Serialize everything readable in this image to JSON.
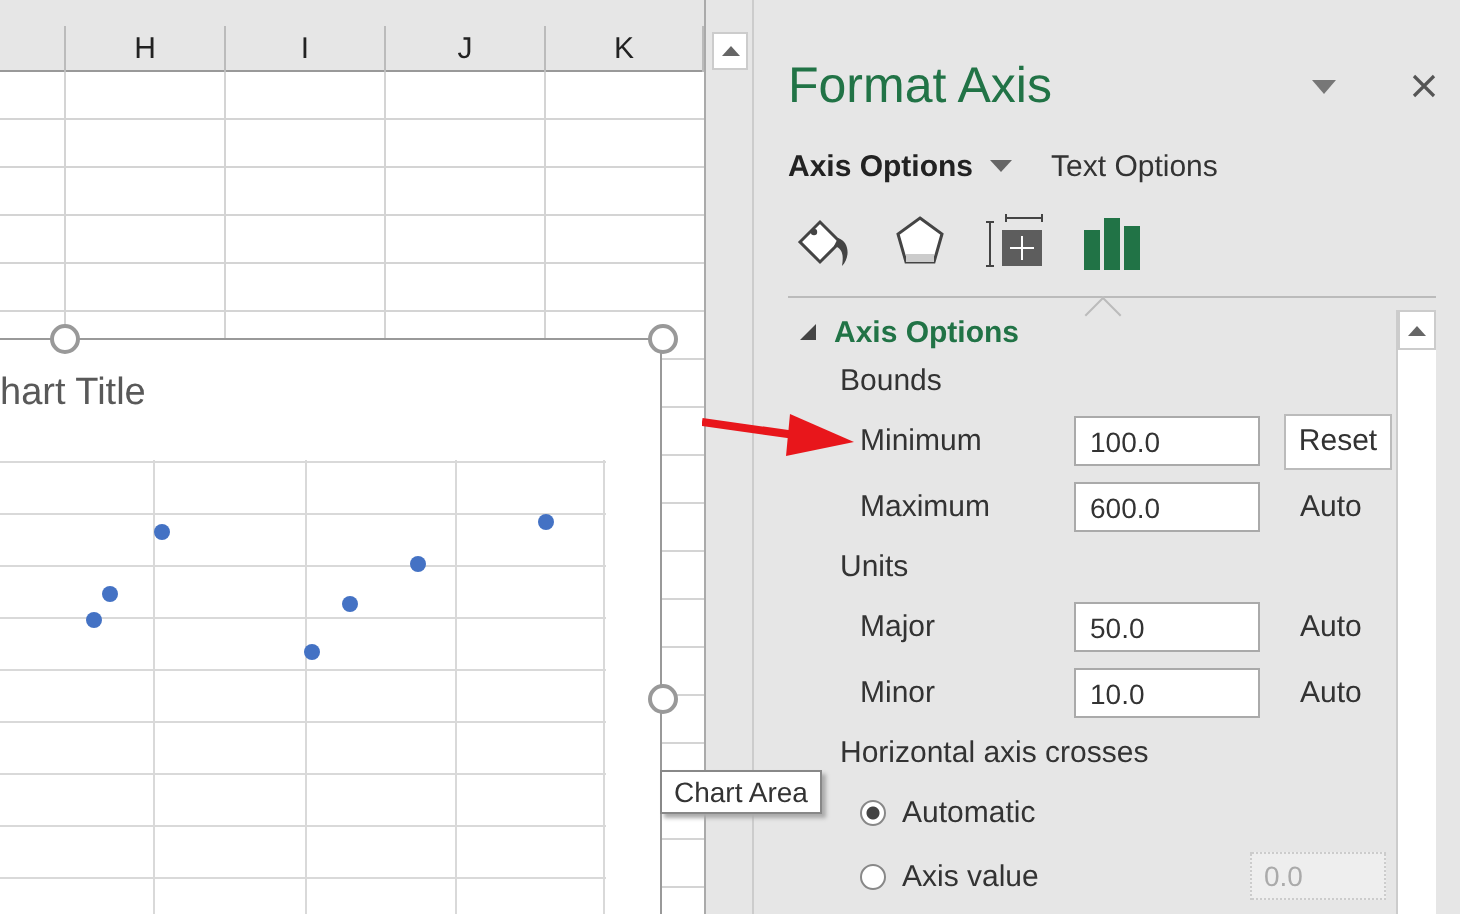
{
  "sheet": {
    "columns": [
      "H",
      "I",
      "J",
      "K"
    ]
  },
  "chart": {
    "title": "hart Title",
    "tooltip": "Chart Area"
  },
  "pane": {
    "title": "Format Axis",
    "tabs": [
      {
        "label": "Axis Options",
        "selected": true
      },
      {
        "label": "Text Options",
        "selected": false
      }
    ],
    "icon_tabs": [
      {
        "kind": "fill",
        "selected": false
      },
      {
        "kind": "effects",
        "selected": false
      },
      {
        "kind": "size",
        "selected": false
      },
      {
        "kind": "axis",
        "selected": true
      }
    ],
    "section": {
      "label": "Axis Options",
      "expanded": true
    },
    "rows": [
      {
        "kind": "heading",
        "label": "Bounds"
      },
      {
        "kind": "field",
        "label": "Minimum",
        "value": "100.0",
        "button": "Reset"
      },
      {
        "kind": "field",
        "label": "Maximum",
        "value": "600.0",
        "note": "Auto"
      },
      {
        "kind": "heading",
        "label": "Units"
      },
      {
        "kind": "field",
        "label": "Major",
        "value": "50.0",
        "note": "Auto"
      },
      {
        "kind": "field",
        "label": "Minor",
        "value": "10.0",
        "note": "Auto"
      },
      {
        "kind": "heading",
        "label": "Horizontal axis crosses"
      },
      {
        "kind": "radio",
        "label": "Automatic",
        "selected": true
      },
      {
        "kind": "radio",
        "label": "Axis value",
        "selected": false,
        "value": "0.0",
        "disabled": true
      }
    ]
  }
}
